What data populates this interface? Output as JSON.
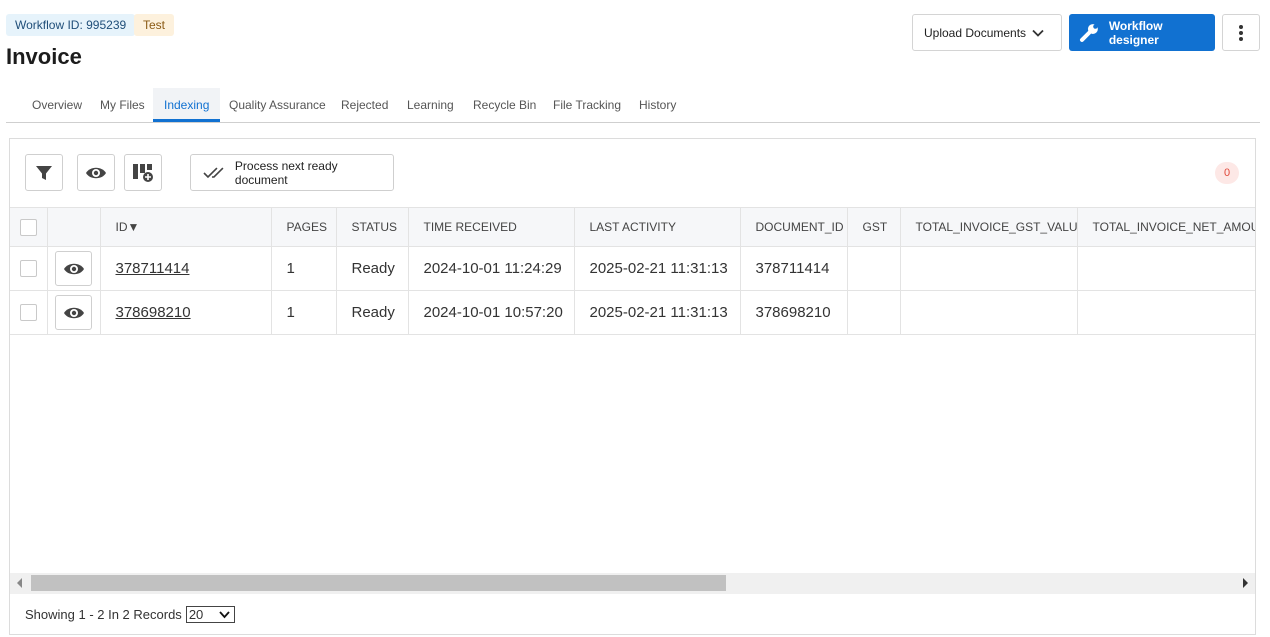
{
  "header": {
    "workflow_badge": "Workflow ID: 995239",
    "env_badge": "Test",
    "title": "Invoice",
    "upload_label": "Upload Documents",
    "designer_label": "Workflow designer"
  },
  "tabs": [
    {
      "label": "Overview",
      "active": false
    },
    {
      "label": "My Files",
      "active": false
    },
    {
      "label": "Indexing",
      "active": true
    },
    {
      "label": "Quality Assurance",
      "active": false
    },
    {
      "label": "Rejected",
      "active": false
    },
    {
      "label": "Learning",
      "active": false
    },
    {
      "label": "Recycle Bin",
      "active": false
    },
    {
      "label": "File Tracking",
      "active": false
    },
    {
      "label": "History",
      "active": false
    }
  ],
  "toolbar": {
    "filter_icon": "filter-icon",
    "view_icon": "eye-icon",
    "columns_icon": "add-column-icon",
    "process_label": "Process next ready document",
    "count": "0"
  },
  "table": {
    "columns": [
      "ID▼",
      "PAGES",
      "STATUS",
      "TIME RECEIVED",
      "LAST ACTIVITY",
      "DOCUMENT_ID",
      "GST",
      "TOTAL_INVOICE_GST_VALUE",
      "TOTAL_INVOICE_NET_AMOUNT"
    ],
    "rows": [
      {
        "id": "378711414",
        "pages": "1",
        "status": "Ready",
        "time_received": "2024-10-01 11:24:29",
        "last_activity": "2025-02-21 11:31:13",
        "document_id": "378711414",
        "gst": "",
        "gst_value": "",
        "net_amount": ""
      },
      {
        "id": "378698210",
        "pages": "1",
        "status": "Ready",
        "time_received": "2024-10-01 10:57:20",
        "last_activity": "2025-02-21 11:31:13",
        "document_id": "378698210",
        "gst": "",
        "gst_value": "",
        "net_amount": ""
      }
    ]
  },
  "footer": {
    "showing": "Showing 1 - 2 In 2 Records",
    "page_size": "20"
  },
  "colors": {
    "accent": "#1171d1",
    "count_badge": "#e0483a"
  }
}
